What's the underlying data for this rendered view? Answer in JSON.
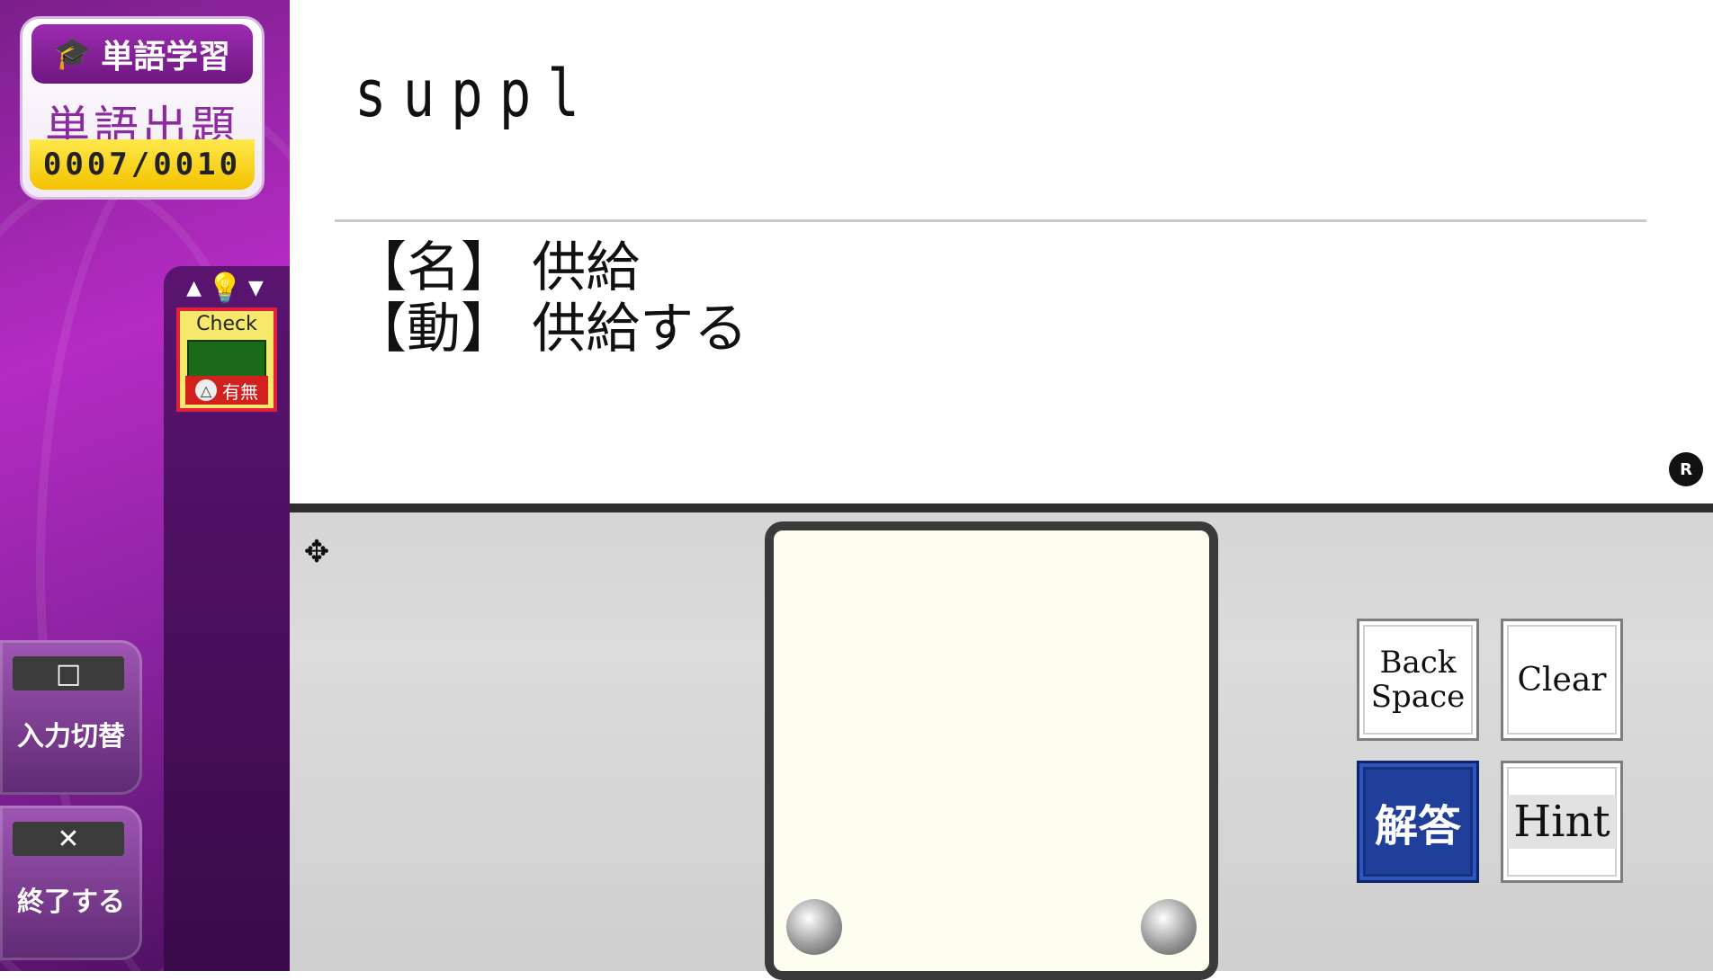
{
  "header": {
    "app_title": "単語学習",
    "mode_title": "単語出題",
    "counter": "0007/0010"
  },
  "check_panel": {
    "label": "Check",
    "toggle_symbol": "△",
    "toggle_label": "有無"
  },
  "sidebar": {
    "input_mode": {
      "key_symbol": "□",
      "label": "入力切替"
    },
    "quit": {
      "key_symbol": "✕",
      "label": "終了する"
    }
  },
  "question": {
    "typed_answer": "suppl",
    "definitions": [
      "【名】 供給",
      "【動】 供給する"
    ]
  },
  "r_indicator": "R",
  "keypad": {
    "backspace_line1": "Back",
    "backspace_line2": "Space",
    "clear": "Clear",
    "answer": "解答",
    "hint": "Hint"
  },
  "colors": {
    "sidebar_purple": "#b52bc4",
    "counter_yellow": "#f2c200",
    "answer_button_blue": "#1f3f9a",
    "pad_background": "#fdfdf0"
  }
}
